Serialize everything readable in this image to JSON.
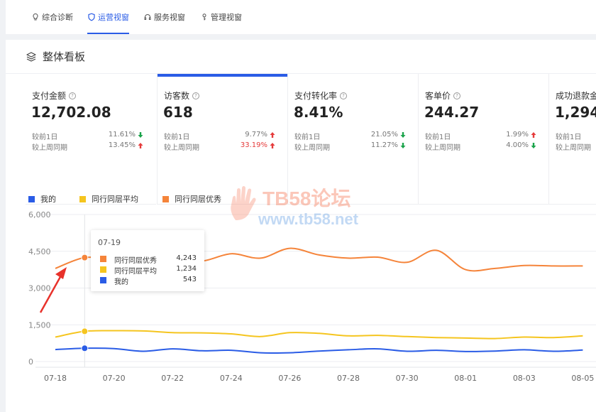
{
  "nav": {
    "tabs": [
      {
        "label": "综合诊断",
        "icon": "bulb-icon"
      },
      {
        "label": "运营视窗",
        "icon": "shield-icon",
        "active": true
      },
      {
        "label": "服务视窗",
        "icon": "headset-icon"
      },
      {
        "label": "管理视窗",
        "icon": "key-icon"
      }
    ]
  },
  "panel": {
    "title": "整体看板",
    "icon": "layers-icon"
  },
  "metrics": [
    {
      "label": "支付金额",
      "value": "12,702.08",
      "row1_label": "较前1日",
      "row1_value": "11.61%",
      "row1_dir": "down",
      "row2_label": "较上周同期",
      "row2_value": "13.45%",
      "row2_dir": "up"
    },
    {
      "label": "访客数",
      "value": "618",
      "row1_label": "较前1日",
      "row1_value": "9.77%",
      "row1_dir": "up",
      "row2_label": "较上周同期",
      "row2_value": "33.19%",
      "row2_dir": "up",
      "active": true
    },
    {
      "label": "支付转化率",
      "value": "8.41%",
      "row1_label": "较前1日",
      "row1_value": "21.05%",
      "row1_dir": "down",
      "row2_label": "较上周同期",
      "row2_value": "11.27%",
      "row2_dir": "down"
    },
    {
      "label": "客单价",
      "value": "244.27",
      "row1_label": "较前1日",
      "row1_value": "1.99%",
      "row1_dir": "up",
      "row2_label": "较上周同期",
      "row2_value": "4.00%",
      "row2_dir": "down"
    },
    {
      "label": "成功退款金",
      "value": "1,294.",
      "row1_label": "较前1日",
      "row1_value": "",
      "row1_dir": "",
      "row2_label": "较上周同期",
      "row2_value": "",
      "row2_dir": ""
    }
  ],
  "colors": {
    "me": "#2a5ce6",
    "peer_avg": "#f5c51f",
    "peer_top": "#f5843a",
    "up": "#e53b3b",
    "down": "#1aa34a",
    "accent": "#2a5ce6"
  },
  "watermark": {
    "line1": "TB58论坛",
    "line2": "www.tb58.net"
  },
  "tooltip": {
    "date": "07-19",
    "rows": [
      {
        "name": "同行同层优秀",
        "value": "4,243",
        "color": "#f5843a"
      },
      {
        "name": "同行同层平均",
        "value": "1,234",
        "color": "#f5c51f"
      },
      {
        "name": "我的",
        "value": "543",
        "color": "#2a5ce6"
      }
    ]
  },
  "chart_data": {
    "type": "line",
    "x": [
      "07-18",
      "07-19",
      "07-20",
      "07-21",
      "07-22",
      "07-23",
      "07-24",
      "07-25",
      "07-26",
      "07-27",
      "07-28",
      "07-29",
      "07-30",
      "07-31",
      "08-01",
      "08-02",
      "08-03",
      "08-04",
      "08-05"
    ],
    "x_tick_labels": [
      "07-18",
      "07-20",
      "07-22",
      "07-24",
      "07-26",
      "07-28",
      "07-30",
      "08-01",
      "08-03",
      "08-05"
    ],
    "y_tick_labels": [
      "6,000",
      "4,500",
      "3,000",
      "1,500",
      "0"
    ],
    "ylim": [
      0,
      6000
    ],
    "grid": true,
    "legend_position": "top-left",
    "series": [
      {
        "name": "我的",
        "color": "#2a5ce6",
        "values": [
          490,
          543,
          530,
          420,
          520,
          440,
          460,
          360,
          360,
          430,
          480,
          520,
          420,
          460,
          410,
          430,
          480,
          420,
          470
        ]
      },
      {
        "name": "同行同层平均",
        "color": "#f5c51f",
        "values": [
          1000,
          1234,
          1260,
          1250,
          1180,
          1170,
          1130,
          1020,
          1180,
          1150,
          1050,
          1070,
          1020,
          980,
          960,
          940,
          1000,
          980,
          1050
        ]
      },
      {
        "name": "同行同层优秀",
        "color": "#f5843a",
        "values": [
          3800,
          4243,
          4150,
          4050,
          4200,
          4100,
          4400,
          4220,
          4620,
          4350,
          4220,
          4260,
          4050,
          4540,
          3750,
          3800,
          3920,
          3900,
          3900
        ]
      }
    ],
    "highlight_index": 1
  }
}
